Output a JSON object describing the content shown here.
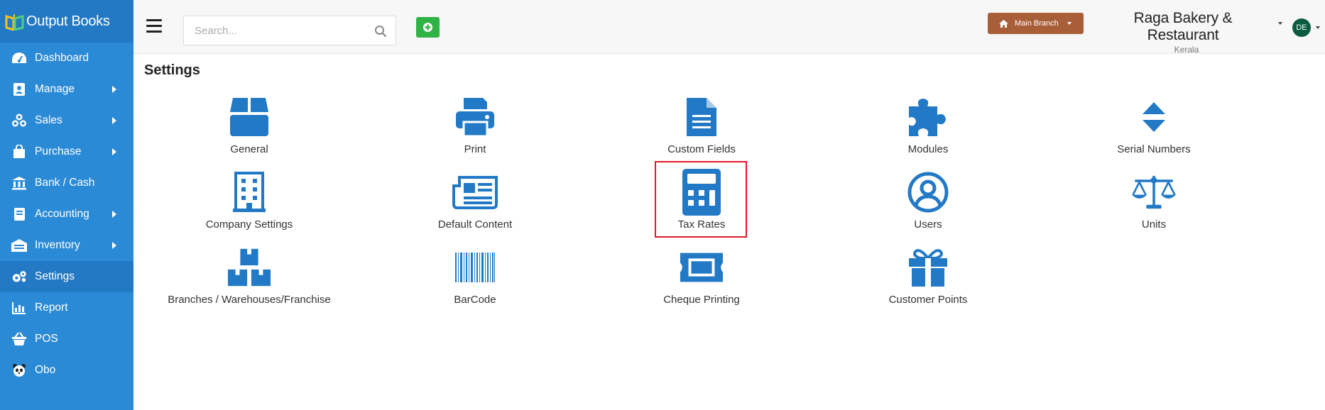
{
  "app": {
    "name": "Output Books"
  },
  "sidebar": {
    "items": [
      {
        "label": "Dashboard",
        "icon": "dashboard-icon",
        "has_submenu": false,
        "active": false
      },
      {
        "label": "Manage",
        "icon": "manage-icon",
        "has_submenu": true,
        "active": false
      },
      {
        "label": "Sales",
        "icon": "sales-icon",
        "has_submenu": true,
        "active": false
      },
      {
        "label": "Purchase",
        "icon": "shopping-bag-icon",
        "has_submenu": true,
        "active": false
      },
      {
        "label": "Bank / Cash",
        "icon": "bank-icon",
        "has_submenu": false,
        "active": false
      },
      {
        "label": "Accounting",
        "icon": "book-icon",
        "has_submenu": true,
        "active": false
      },
      {
        "label": "Inventory",
        "icon": "warehouse-icon",
        "has_submenu": true,
        "active": false
      },
      {
        "label": "Settings",
        "icon": "gears-icon",
        "has_submenu": false,
        "active": true
      },
      {
        "label": "Report",
        "icon": "bar-chart-icon",
        "has_submenu": false,
        "active": false
      },
      {
        "label": "POS",
        "icon": "basket-icon",
        "has_submenu": false,
        "active": false
      },
      {
        "label": "Obo",
        "icon": "panda-icon",
        "has_submenu": false,
        "active": false
      }
    ]
  },
  "header": {
    "search_placeholder": "Search...",
    "branch_label": "Main Branch",
    "company_name": "Raga Bakery & Restaurant",
    "company_location": "Kerala",
    "avatar_initials": "DE"
  },
  "page": {
    "title": "Settings",
    "tiles": [
      {
        "label": "General",
        "icon": "box-icon"
      },
      {
        "label": "Print",
        "icon": "printer-icon"
      },
      {
        "label": "Custom Fields",
        "icon": "file-icon"
      },
      {
        "label": "Modules",
        "icon": "puzzle-icon"
      },
      {
        "label": "Serial Numbers",
        "icon": "sort-icon"
      },
      {
        "label": "Company Settings",
        "icon": "building-icon"
      },
      {
        "label": "Default Content",
        "icon": "newspaper-icon"
      },
      {
        "label": "Tax Rates",
        "icon": "calculator-icon",
        "highlighted": true
      },
      {
        "label": "Users",
        "icon": "user-circle-icon"
      },
      {
        "label": "Units",
        "icon": "balance-scale-icon"
      },
      {
        "label": "Branches / Warehouses/Franchise",
        "icon": "cubes-icon"
      },
      {
        "label": "BarCode",
        "icon": "barcode-icon"
      },
      {
        "label": "Cheque Printing",
        "icon": "cheque-icon"
      },
      {
        "label": "Customer Points",
        "icon": "gift-icon"
      }
    ]
  },
  "colors": {
    "sidebar": "#2b8ad6",
    "sidebar_active": "#2379c3",
    "icon_blue": "#2279c5",
    "add_button": "#2fb344",
    "branch_button": "#a85f39",
    "highlight_border": "#e0192b"
  }
}
